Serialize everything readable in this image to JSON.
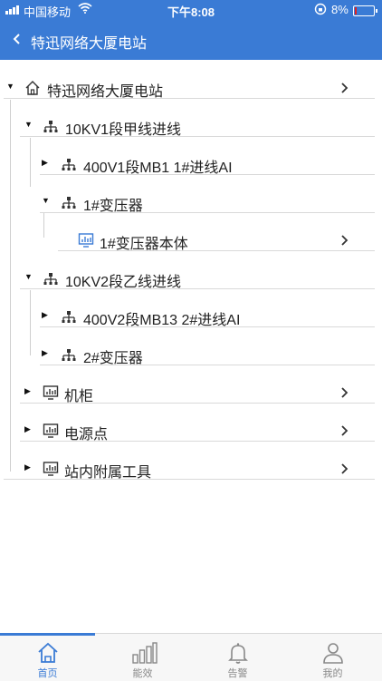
{
  "status_bar": {
    "carrier": "中国移动",
    "time": "下午8:08",
    "battery_text": "8%",
    "battery_level": 0.08
  },
  "nav": {
    "title": "特迅网络大厦电站"
  },
  "tree": {
    "root": "特迅网络大厦电站",
    "line1": "10KV1段甲线进线",
    "line1_child1": "400V1段MB1 1#进线AI",
    "line1_child2": "1#变压器",
    "line1_child2_child": "1#变压器本体",
    "line2": "10KV2段乙线进线",
    "line2_child1": "400V2段MB13 2#进线AI",
    "line2_child2": "2#变压器",
    "cabinet": "机柜",
    "power_point": "电源点",
    "tools": "站内附属工具"
  },
  "tabs": [
    {
      "label": "首页",
      "icon": "home-icon"
    },
    {
      "label": "能效",
      "icon": "bar-chart-icon"
    },
    {
      "label": "告警",
      "icon": "bell-icon"
    },
    {
      "label": "我的",
      "icon": "user-icon"
    }
  ],
  "colors": {
    "primary": "#3a7bd5",
    "battery_low": "#e02020"
  }
}
